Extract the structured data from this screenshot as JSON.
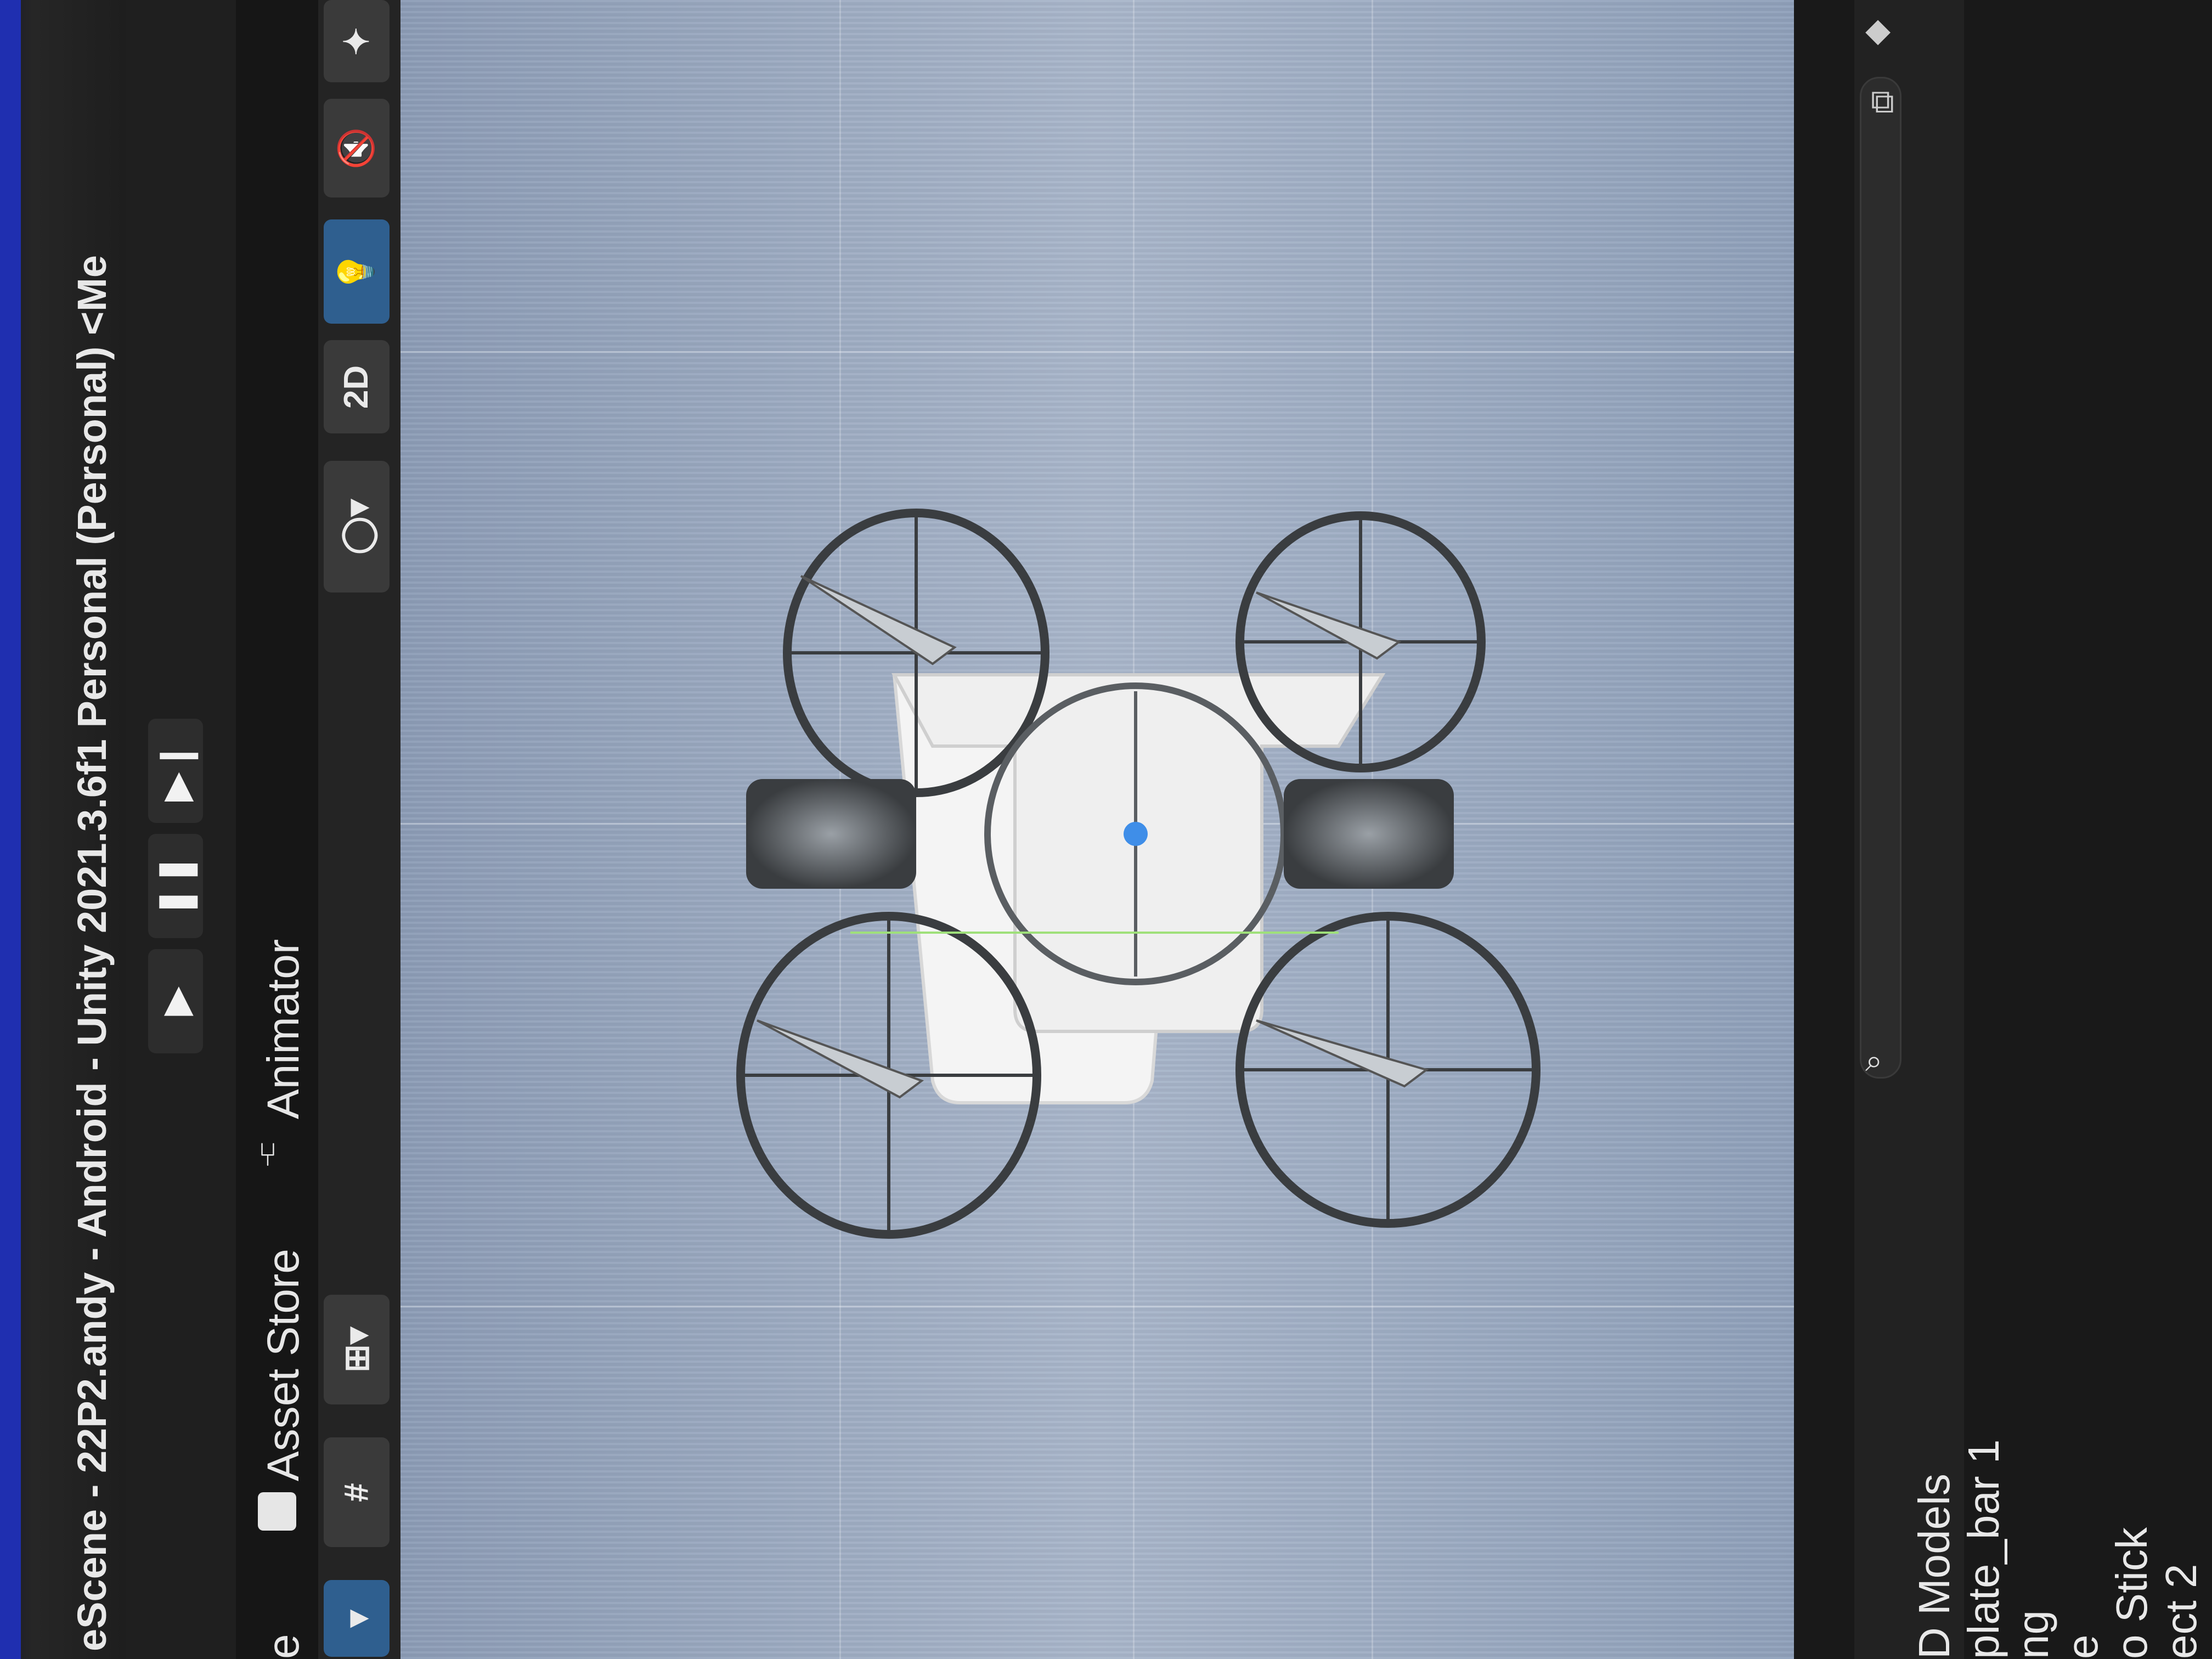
{
  "window": {
    "title": "eScene - 22P2.andy - Android - Unity 2021.3.6f1 Personal (Personal) <Me"
  },
  "play_controls": {
    "play_icon": "play-icon",
    "pause_icon": "pause-icon",
    "step_icon": "step-icon",
    "play_glyph": "▶",
    "pause_glyph": "❚❚",
    "step_glyph": "▶❙"
  },
  "tabs": {
    "items": [
      {
        "label": "e"
      },
      {
        "label": "Asset Store"
      },
      {
        "label": "Animator"
      }
    ]
  },
  "scene_toolbar": {
    "mode_2d_label": "2D",
    "shading_glyph": "◯▾",
    "light_glyph": "💡",
    "audio_glyph": "🔇",
    "effects_glyph": "✦",
    "grid_glyph": "#",
    "snap_glyph": "⊞▾"
  },
  "hierarchy": {
    "items": [
      {
        "label": "D Models"
      },
      {
        "label": "plate_bar 1"
      },
      {
        "label": "ng"
      },
      {
        "label": "e"
      },
      {
        "label": "o Stick"
      },
      {
        "label": "ect 2"
      }
    ]
  },
  "colors": {
    "viewport_bg": "#a3b0c4",
    "frame_metal": "#3a3d40",
    "plate": "#eeeeee",
    "pivot": "#3f8ee8",
    "title_bg": "#1e1e1e",
    "active_tool": "#2f5f8f"
  }
}
